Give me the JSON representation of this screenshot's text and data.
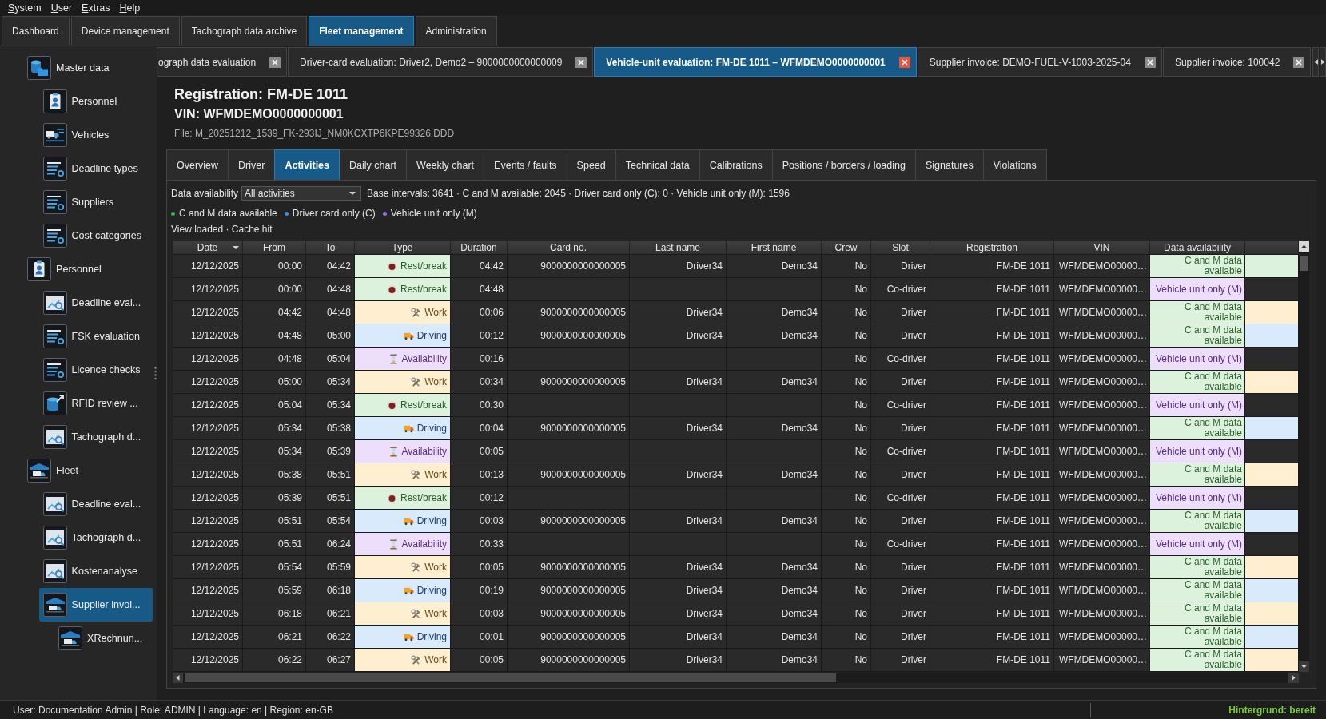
{
  "menu": [
    "System",
    "User",
    "Extras",
    "Help"
  ],
  "main_tabs": [
    {
      "label": "Dashboard",
      "selected": false
    },
    {
      "label": "Device management",
      "selected": false
    },
    {
      "label": "Tachograph data archive",
      "selected": false
    },
    {
      "label": "Fleet management",
      "selected": true
    },
    {
      "label": "Administration",
      "selected": false
    }
  ],
  "sidebar": {
    "items": [
      {
        "label": "Master data",
        "kind": "data",
        "selected": false,
        "children": [
          {
            "label": "Personnel",
            "kind": "badge",
            "selected": false
          },
          {
            "label": "Vehicles",
            "kind": "vehicles",
            "selected": false
          },
          {
            "label": "Deadline types",
            "kind": "list",
            "selected": false
          },
          {
            "label": "Suppliers",
            "kind": "list",
            "selected": false
          },
          {
            "label": "Cost categories",
            "kind": "list",
            "selected": false
          }
        ]
      },
      {
        "label": "Personnel",
        "kind": "badge",
        "selected": false,
        "children": [
          {
            "label": "Deadline eval...",
            "kind": "chart",
            "selected": false
          },
          {
            "label": "FSK evaluation",
            "kind": "list",
            "selected": false
          },
          {
            "label": "Licence checks",
            "kind": "list",
            "selected": false
          },
          {
            "label": "RFID review ...",
            "kind": "export",
            "selected": false
          },
          {
            "label": "Tachograph d...",
            "kind": "chart",
            "selected": false
          }
        ]
      },
      {
        "label": "Fleet",
        "kind": "fleet",
        "selected": false,
        "children": [
          {
            "label": "Deadline eval...",
            "kind": "chart",
            "selected": false
          },
          {
            "label": "Tachograph d...",
            "kind": "chart",
            "selected": false
          },
          {
            "label": "Kostenanalyse",
            "kind": "chart",
            "selected": false
          },
          {
            "label": "Supplier invoi...",
            "kind": "fleet",
            "selected": true,
            "children": [
              {
                "label": "XRechnun...",
                "kind": "fleet",
                "selected": false
              }
            ]
          }
        ]
      }
    ]
  },
  "document_tabs": [
    {
      "label": "ograph data evaluation",
      "selected": false
    },
    {
      "label": "Driver-card evaluation: Driver2, Demo2 – 9000000000000009",
      "selected": false
    },
    {
      "label": "Vehicle-unit evaluation: FM-DE 1011 – WFMDEMO0000000001",
      "selected": true
    },
    {
      "label": "Supplier invoice: DEMO-FUEL-V-1003-2025-04",
      "selected": false
    },
    {
      "label": "Supplier invoice: 100042",
      "selected": false
    }
  ],
  "header": {
    "registration": "Registration: FM-DE 1011",
    "vin": "VIN: WFMDEMO0000000001",
    "file": "File: M_20251212_1539_FK-293IJ_NM0KCXTP6KPE99326.DDD"
  },
  "sub_tabs": [
    {
      "label": "Overview",
      "selected": false
    },
    {
      "label": "Driver",
      "selected": false
    },
    {
      "label": "Activities",
      "selected": true
    },
    {
      "label": "Daily chart",
      "selected": false
    },
    {
      "label": "Weekly chart",
      "selected": false
    },
    {
      "label": "Events / faults",
      "selected": false
    },
    {
      "label": "Speed",
      "selected": false
    },
    {
      "label": "Technical data",
      "selected": false
    },
    {
      "label": "Calibrations",
      "selected": false
    },
    {
      "label": "Positions / borders / loading",
      "selected": false
    },
    {
      "label": "Signatures",
      "selected": false
    },
    {
      "label": "Violations",
      "selected": false
    }
  ],
  "filter": {
    "label": "Data availability",
    "value": "All activities",
    "summary": "Base intervals: 3641 · C and M available: 2045 · Driver card only (C): 0 · Vehicle unit only (M): 1596"
  },
  "legend": [
    {
      "label": "C and M data available",
      "color": "#3fae5a"
    },
    {
      "label": "Driver card only (C)",
      "color": "#3d8fe0"
    },
    {
      "label": "Vehicle unit only (M)",
      "color": "#9f6fdf"
    }
  ],
  "view_status": "View loaded · Cache hit",
  "table": {
    "columns": [
      {
        "label": "Date",
        "sorted": true
      },
      {
        "label": "From",
        "sorted": false
      },
      {
        "label": "To",
        "sorted": false
      },
      {
        "label": "Type",
        "sorted": false
      },
      {
        "label": "Duration",
        "sorted": false
      },
      {
        "label": "Card no.",
        "sorted": false
      },
      {
        "label": "Last name",
        "sorted": false
      },
      {
        "label": "First name",
        "sorted": false
      },
      {
        "label": "Crew",
        "sorted": false
      },
      {
        "label": "Slot",
        "sorted": false
      },
      {
        "label": "Registration",
        "sorted": false
      },
      {
        "label": "VIN",
        "sorted": false
      },
      {
        "label": "Data availability",
        "sorted": false
      }
    ],
    "rows": [
      {
        "date": "12/12/2025",
        "from": "00:00",
        "to": "04:42",
        "type": {
          "kind": "rest",
          "label": "Rest/break"
        },
        "duration": "04:42",
        "card_no": "9000000000000005",
        "last_name": "Driver34",
        "first_name": "Demo34",
        "crew": "No",
        "slot": "Driver",
        "registration": "FM-DE 1011",
        "vin": "WFMDEMO00000…",
        "availability": {
          "kind": "cm",
          "label": "C and M data available"
        }
      },
      {
        "date": "12/12/2025",
        "from": "00:00",
        "to": "04:48",
        "type": {
          "kind": "rest",
          "label": "Rest/break"
        },
        "duration": "04:48",
        "crew": "No",
        "slot": "Co-driver",
        "registration": "FM-DE 1011",
        "vin": "WFMDEMO00000…",
        "availability": {
          "kind": "vu",
          "label": "Vehicle unit only (M)"
        }
      },
      {
        "date": "12/12/2025",
        "from": "04:42",
        "to": "04:48",
        "type": {
          "kind": "work",
          "label": "Work"
        },
        "duration": "00:06",
        "card_no": "9000000000000005",
        "last_name": "Driver34",
        "first_name": "Demo34",
        "crew": "No",
        "slot": "Driver",
        "registration": "FM-DE 1011",
        "vin": "WFMDEMO00000…",
        "availability": {
          "kind": "cm",
          "label": "C and M data available"
        }
      },
      {
        "date": "12/12/2025",
        "from": "04:48",
        "to": "05:00",
        "type": {
          "kind": "driving",
          "label": "Driving"
        },
        "duration": "00:12",
        "card_no": "9000000000000005",
        "last_name": "Driver34",
        "first_name": "Demo34",
        "crew": "No",
        "slot": "Driver",
        "registration": "FM-DE 1011",
        "vin": "WFMDEMO00000…",
        "availability": {
          "kind": "cm",
          "label": "C and M data available"
        }
      },
      {
        "date": "12/12/2025",
        "from": "04:48",
        "to": "05:04",
        "type": {
          "kind": "availability",
          "label": "Availability"
        },
        "duration": "00:16",
        "crew": "No",
        "slot": "Co-driver",
        "registration": "FM-DE 1011",
        "vin": "WFMDEMO00000…",
        "availability": {
          "kind": "vu",
          "label": "Vehicle unit only (M)"
        }
      },
      {
        "date": "12/12/2025",
        "from": "05:00",
        "to": "05:34",
        "type": {
          "kind": "work",
          "label": "Work"
        },
        "duration": "00:34",
        "card_no": "9000000000000005",
        "last_name": "Driver34",
        "first_name": "Demo34",
        "crew": "No",
        "slot": "Driver",
        "registration": "FM-DE 1011",
        "vin": "WFMDEMO00000…",
        "availability": {
          "kind": "cm",
          "label": "C and M data available"
        }
      },
      {
        "date": "12/12/2025",
        "from": "05:04",
        "to": "05:34",
        "type": {
          "kind": "rest",
          "label": "Rest/break"
        },
        "duration": "00:30",
        "crew": "No",
        "slot": "Co-driver",
        "registration": "FM-DE 1011",
        "vin": "WFMDEMO00000…",
        "availability": {
          "kind": "vu",
          "label": "Vehicle unit only (M)"
        }
      },
      {
        "date": "12/12/2025",
        "from": "05:34",
        "to": "05:38",
        "type": {
          "kind": "driving",
          "label": "Driving"
        },
        "duration": "00:04",
        "card_no": "9000000000000005",
        "last_name": "Driver34",
        "first_name": "Demo34",
        "crew": "No",
        "slot": "Driver",
        "registration": "FM-DE 1011",
        "vin": "WFMDEMO00000…",
        "availability": {
          "kind": "cm",
          "label": "C and M data available"
        }
      },
      {
        "date": "12/12/2025",
        "from": "05:34",
        "to": "05:39",
        "type": {
          "kind": "availability",
          "label": "Availability"
        },
        "duration": "00:05",
        "crew": "No",
        "slot": "Co-driver",
        "registration": "FM-DE 1011",
        "vin": "WFMDEMO00000…",
        "availability": {
          "kind": "vu",
          "label": "Vehicle unit only (M)"
        }
      },
      {
        "date": "12/12/2025",
        "from": "05:38",
        "to": "05:51",
        "type": {
          "kind": "work",
          "label": "Work"
        },
        "duration": "00:13",
        "card_no": "9000000000000005",
        "last_name": "Driver34",
        "first_name": "Demo34",
        "crew": "No",
        "slot": "Driver",
        "registration": "FM-DE 1011",
        "vin": "WFMDEMO00000…",
        "availability": {
          "kind": "cm",
          "label": "C and M data available"
        }
      },
      {
        "date": "12/12/2025",
        "from": "05:39",
        "to": "05:51",
        "type": {
          "kind": "rest",
          "label": "Rest/break"
        },
        "duration": "00:12",
        "crew": "No",
        "slot": "Co-driver",
        "registration": "FM-DE 1011",
        "vin": "WFMDEMO00000…",
        "availability": {
          "kind": "vu",
          "label": "Vehicle unit only (M)"
        }
      },
      {
        "date": "12/12/2025",
        "from": "05:51",
        "to": "05:54",
        "type": {
          "kind": "driving",
          "label": "Driving"
        },
        "duration": "00:03",
        "card_no": "9000000000000005",
        "last_name": "Driver34",
        "first_name": "Demo34",
        "crew": "No",
        "slot": "Driver",
        "registration": "FM-DE 1011",
        "vin": "WFMDEMO00000…",
        "availability": {
          "kind": "cm",
          "label": "C and M data available"
        }
      },
      {
        "date": "12/12/2025",
        "from": "05:51",
        "to": "06:24",
        "type": {
          "kind": "availability",
          "label": "Availability"
        },
        "duration": "00:33",
        "crew": "No",
        "slot": "Co-driver",
        "registration": "FM-DE 1011",
        "vin": "WFMDEMO00000…",
        "availability": {
          "kind": "vu",
          "label": "Vehicle unit only (M)"
        }
      },
      {
        "date": "12/12/2025",
        "from": "05:54",
        "to": "05:59",
        "type": {
          "kind": "work",
          "label": "Work"
        },
        "duration": "00:05",
        "card_no": "9000000000000005",
        "last_name": "Driver34",
        "first_name": "Demo34",
        "crew": "No",
        "slot": "Driver",
        "registration": "FM-DE 1011",
        "vin": "WFMDEMO00000…",
        "availability": {
          "kind": "cm",
          "label": "C and M data available"
        }
      },
      {
        "date": "12/12/2025",
        "from": "05:59",
        "to": "06:18",
        "type": {
          "kind": "driving",
          "label": "Driving"
        },
        "duration": "00:19",
        "card_no": "9000000000000005",
        "last_name": "Driver34",
        "first_name": "Demo34",
        "crew": "No",
        "slot": "Driver",
        "registration": "FM-DE 1011",
        "vin": "WFMDEMO00000…",
        "availability": {
          "kind": "cm",
          "label": "C and M data available"
        }
      },
      {
        "date": "12/12/2025",
        "from": "06:18",
        "to": "06:21",
        "type": {
          "kind": "work",
          "label": "Work"
        },
        "duration": "00:03",
        "card_no": "9000000000000005",
        "last_name": "Driver34",
        "first_name": "Demo34",
        "crew": "No",
        "slot": "Driver",
        "registration": "FM-DE 1011",
        "vin": "WFMDEMO00000…",
        "availability": {
          "kind": "cm",
          "label": "C and M data available"
        }
      },
      {
        "date": "12/12/2025",
        "from": "06:21",
        "to": "06:22",
        "type": {
          "kind": "driving",
          "label": "Driving"
        },
        "duration": "00:01",
        "card_no": "9000000000000005",
        "last_name": "Driver34",
        "first_name": "Demo34",
        "crew": "No",
        "slot": "Driver",
        "registration": "FM-DE 1011",
        "vin": "WFMDEMO00000…",
        "availability": {
          "kind": "cm",
          "label": "C and M data available"
        }
      },
      {
        "date": "12/12/2025",
        "from": "06:22",
        "to": "06:27",
        "type": {
          "kind": "work",
          "label": "Work"
        },
        "duration": "00:05",
        "card_no": "9000000000000005",
        "last_name": "Driver34",
        "first_name": "Demo34",
        "crew": "No",
        "slot": "Driver",
        "registration": "FM-DE 1011",
        "vin": "WFMDEMO00000…",
        "availability": {
          "kind": "cm",
          "label": "C and M data available"
        }
      }
    ]
  },
  "status_bar": {
    "left": "User: Documentation Admin | Role: ADMIN | Language: en | Region: en-GB",
    "right": "Hintergrund: bereit"
  }
}
